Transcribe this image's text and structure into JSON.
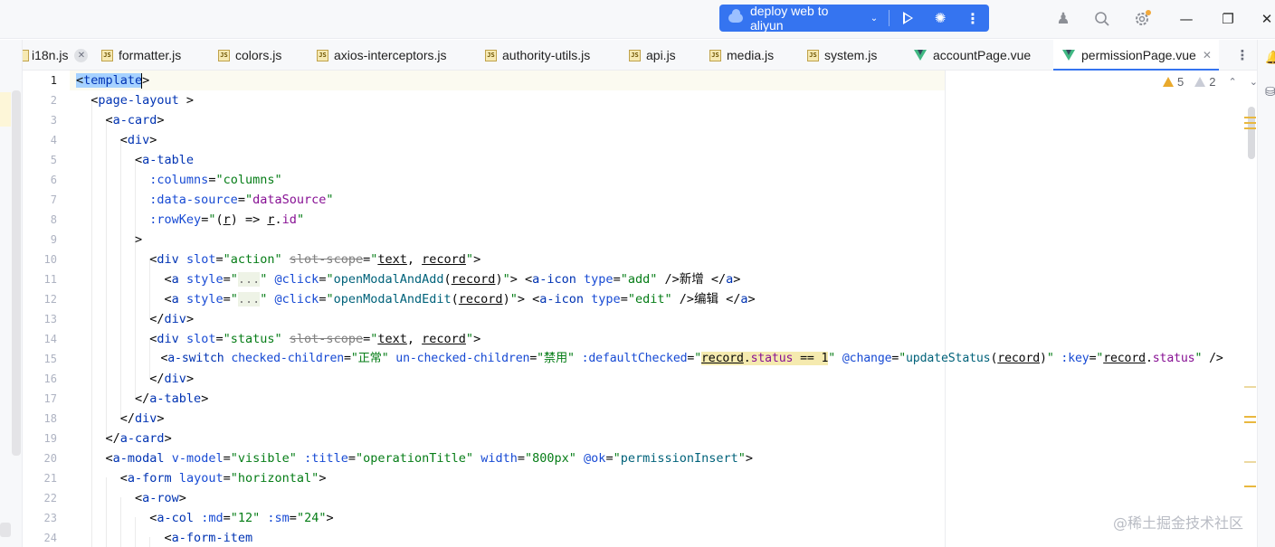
{
  "titlebar": {
    "run_config": "deploy web to aliyun",
    "icons": [
      "cloud-icon",
      "play-icon",
      "bug-icon",
      "more-vertical-icon",
      "add-user-icon",
      "search-icon",
      "gear-icon",
      "minimize-icon",
      "restore-icon",
      "close-icon"
    ]
  },
  "tabs": [
    {
      "label": "i18n.js",
      "icon": "js",
      "closable": true
    },
    {
      "label": "formatter.js",
      "icon": "js"
    },
    {
      "label": "colors.js",
      "icon": "js"
    },
    {
      "label": "axios-interceptors.js",
      "icon": "js"
    },
    {
      "label": "authority-utils.js",
      "icon": "js"
    },
    {
      "label": "api.js",
      "icon": "js"
    },
    {
      "label": "media.js",
      "icon": "js"
    },
    {
      "label": "system.js",
      "icon": "js"
    },
    {
      "label": "accountPage.vue",
      "icon": "vue"
    },
    {
      "label": "permissionPage.vue",
      "icon": "vue",
      "active": true,
      "closable": true
    }
  ],
  "inspections": {
    "warnings": "5",
    "weak_warnings": "2"
  },
  "editor": {
    "current_line": 1,
    "line_numbers": [
      "1",
      "2",
      "3",
      "4",
      "5",
      "6",
      "7",
      "8",
      "9",
      "10",
      "11",
      "12",
      "13",
      "14",
      "15",
      "16",
      "17",
      "18",
      "19",
      "20",
      "21",
      "22",
      "23",
      "24"
    ],
    "strings": {
      "template": "template",
      "page_layout": "page-layout",
      "a_card": "a-card",
      "div": "div",
      "a_table": "a-table",
      "columns_attr": ":columns",
      "columns_val": "columns",
      "data_source_attr": ":data-source",
      "data_source_val": "dataSource",
      "rowkey_attr": ":rowKey",
      "r": "r",
      "id": "id",
      "slot_attr": "slot",
      "slot_action": "action",
      "slot_scope": "slot-scope",
      "text": "text",
      "record": "record",
      "a": "a",
      "style_attr": "style",
      "ellipsis": "...",
      "click_attr": "@click",
      "open_add": "openModalAndAdd",
      "open_edit": "openModalAndEdit",
      "a_icon": "a-icon",
      "type_attr": "type",
      "add": "add",
      "edit": "edit",
      "xinzeng": "新增",
      "bianji": "编辑",
      "slot_status": "status",
      "a_switch": "a-switch",
      "checked_children": "checked-children",
      "zhengchang": "正常",
      "unchecked_children": "un-checked-children",
      "jinyong": "禁用",
      "default_checked": ":defaultChecked",
      "status": "status",
      "eq_one": "== 1",
      "change_attr": "@change",
      "update_status": "updateStatus",
      "key_attr": ":key",
      "a_modal": "a-modal",
      "v_model": "v-model",
      "visible": "visible",
      "title_attr": ":title",
      "operation_title": "operationTitle",
      "width_attr": "width",
      "width_val": "800px",
      "ok_attr": "@ok",
      "permission_insert": "permissionInsert",
      "a_form": "a-form",
      "layout_attr": "layout",
      "horizontal": "horizontal",
      "a_row": "a-row",
      "a_col": "a-col",
      "md_attr": ":md",
      "md_val": "12",
      "sm_attr": ":sm",
      "sm_val": "24",
      "a_form_item": "a-form-item"
    }
  },
  "watermark": "@稀土掘金技术社区"
}
